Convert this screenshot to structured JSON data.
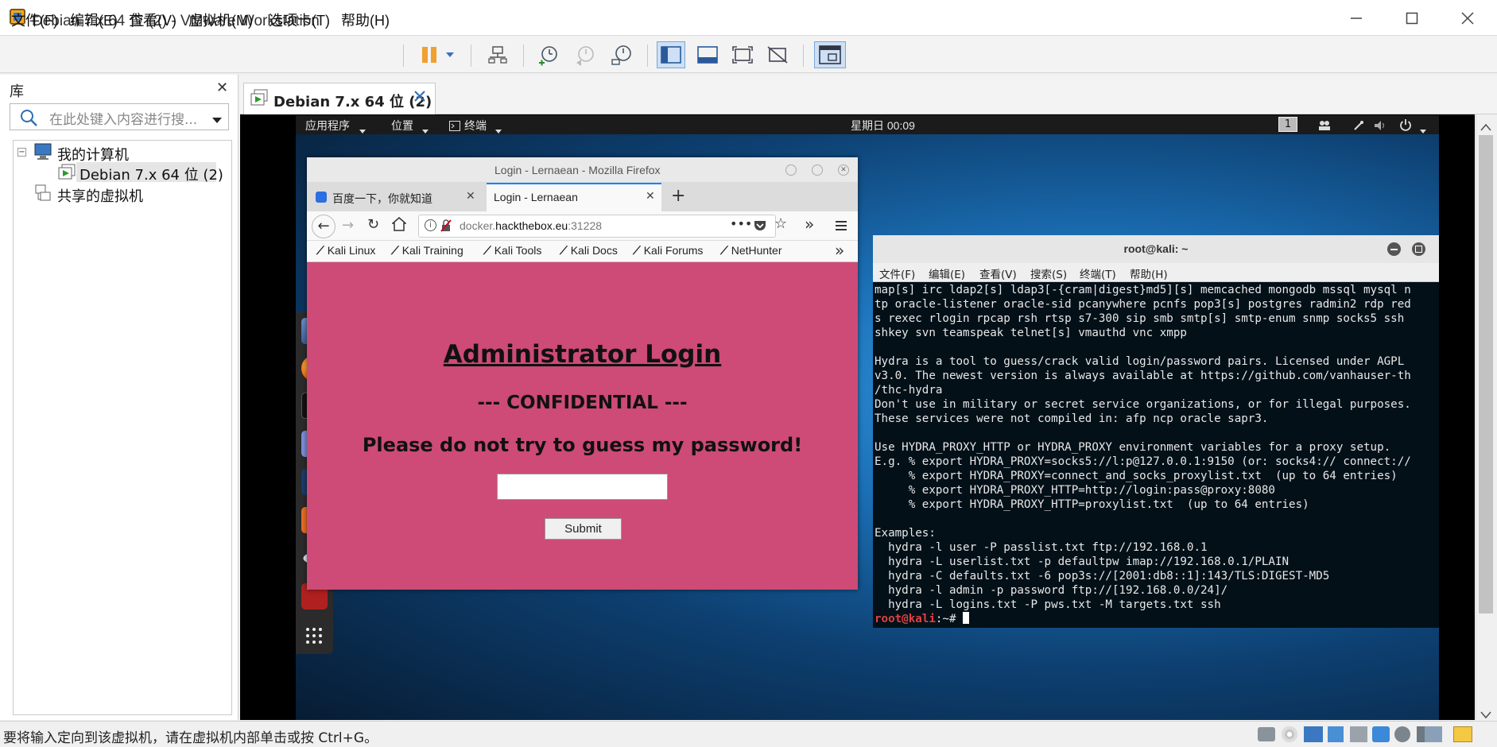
{
  "window": {
    "title": "Debian 7.x 64 位 (2) - VMware Workstation"
  },
  "menubar": {
    "items": [
      "文件(F)",
      "编辑(E)",
      "查看(V)",
      "虚拟机(M)",
      "选项卡(T)",
      "帮助(H)"
    ]
  },
  "library": {
    "title": "库",
    "search_placeholder": "在此处键入内容进行搜...",
    "tree": {
      "root": "我的计算机",
      "vm": "Debian 7.x 64 位 (2)",
      "shared": "共享的虚拟机"
    }
  },
  "vm_tab": {
    "label": "Debian 7.x 64 位 (2)"
  },
  "guest": {
    "topbar": {
      "applications": "应用程序",
      "places": "位置",
      "terminal": "终端",
      "clock": "星期日 00:09",
      "workspace": "1"
    },
    "firefox": {
      "window_title": "Login - Lernaean - Mozilla Firefox",
      "tabs": [
        "百度一下，你就知道",
        "Login - Lernaean"
      ],
      "url_prefix": "docker.",
      "url_domain": "hackthebox.eu",
      "url_port": ":31228",
      "bookmarks": [
        "Kali Linux",
        "Kali Training",
        "Kali Tools",
        "Kali Docs",
        "Kali Forums",
        "NetHunter"
      ],
      "page": {
        "heading": "Administrator Login",
        "subheading": "--- CONFIDENTIAL ---",
        "message": "Please do not try to guess my password!",
        "submit": "Submit"
      }
    },
    "terminal": {
      "title": "root@kali: ~",
      "menu": [
        "文件(F)",
        "编辑(E)",
        "查看(V)",
        "搜索(S)",
        "终端(T)",
        "帮助(H)"
      ],
      "lines": [
        "map[s] irc ldap2[s] ldap3[-{cram|digest}md5][s] memcached mongodb mssql mysql n",
        "tp oracle-listener oracle-sid pcanywhere pcnfs pop3[s] postgres radmin2 rdp red",
        "s rexec rlogin rpcap rsh rtsp s7-300 sip smb smtp[s] smtp-enum snmp socks5 ssh",
        "shkey svn teamspeak telnet[s] vmauthd vnc xmpp",
        "",
        "Hydra is a tool to guess/crack valid login/password pairs. Licensed under AGPL",
        "v3.0. The newest version is always available at https://github.com/vanhauser-th",
        "/thc-hydra",
        "Don't use in military or secret service organizations, or for illegal purposes.",
        "These services were not compiled in: afp ncp oracle sapr3.",
        "",
        "Use HYDRA_PROXY_HTTP or HYDRA_PROXY environment variables for a proxy setup.",
        "E.g. % export HYDRA_PROXY=socks5://l:p@127.0.0.1:9150 (or: socks4:// connect://",
        "     % export HYDRA_PROXY=connect_and_socks_proxylist.txt  (up to 64 entries)",
        "     % export HYDRA_PROXY_HTTP=http://login:pass@proxy:8080",
        "     % export HYDRA_PROXY_HTTP=proxylist.txt  (up to 64 entries)",
        "",
        "Examples:",
        "  hydra -l user -P passlist.txt ftp://192.168.0.1",
        "  hydra -L userlist.txt -p defaultpw imap://192.168.0.1/PLAIN",
        "  hydra -C defaults.txt -6 pop3s://[2001:db8::1]:143/TLS:DIGEST-MD5",
        "  hydra -l admin -p password ftp://[192.168.0.0/24]/",
        "  hydra -L logins.txt -P pws.txt -M targets.txt ssh"
      ],
      "prompt_user": "root@kali",
      "prompt_rest": ":~# "
    }
  },
  "statusbar": {
    "message": "要将输入定向到该虚拟机，请在虚拟机内部单击或按 Ctrl+G。"
  },
  "colors": {
    "page_bg": "#cd4b76",
    "terminal_bg": "#031018",
    "prompt": "#e04040",
    "pause_button": "#f0a030"
  }
}
